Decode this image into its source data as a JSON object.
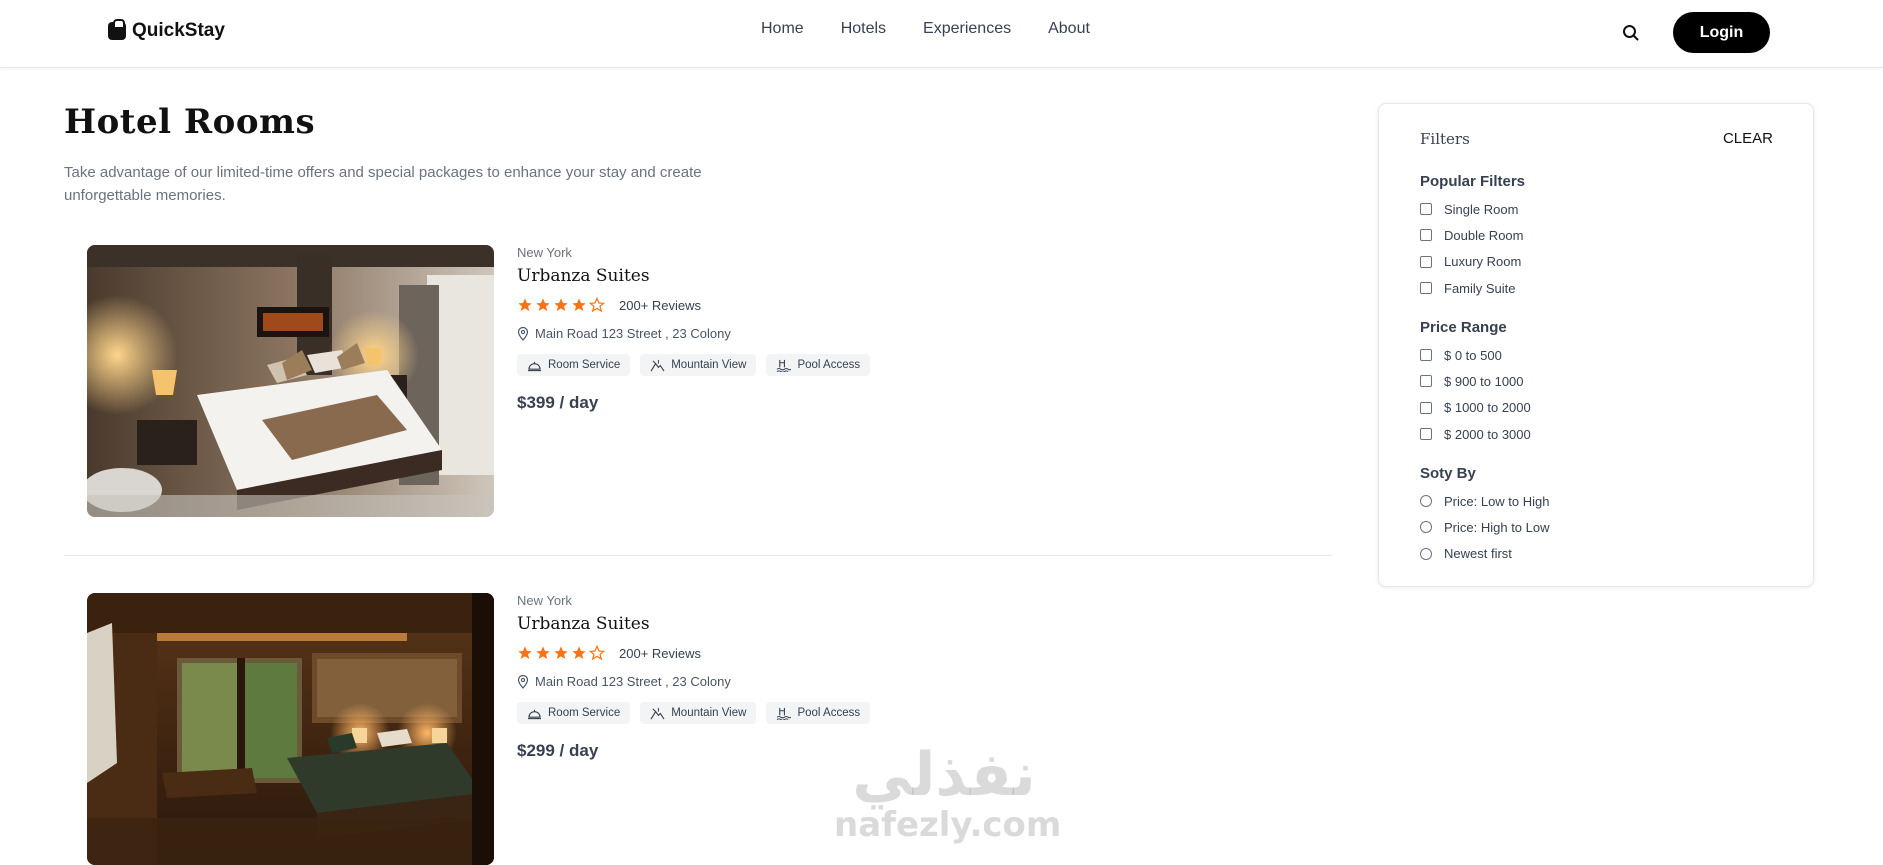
{
  "navbar": {
    "logo": "QuickStay",
    "links": [
      "Home",
      "Hotels",
      "Experiences",
      "About"
    ],
    "login_label": "Login"
  },
  "header": {
    "title": "Hotel Rooms",
    "subtitle": "Take advantage of our limited-time offers and special packages to enhance your stay and create unforgettable memories."
  },
  "rooms": [
    {
      "city": "New York",
      "name": "Urbanza Suites",
      "rating": 4,
      "reviews": "200+ Reviews",
      "address": "Main Road 123 Street , 23 Colony",
      "amenities": [
        "Room Service",
        "Mountain View",
        "Pool Access"
      ],
      "price": "$399 / day"
    },
    {
      "city": "New York",
      "name": "Urbanza Suites",
      "rating": 4,
      "reviews": "200+ Reviews",
      "address": "Main Road 123 Street , 23 Colony",
      "amenities": [
        "Room Service",
        "Mountain View",
        "Pool Access"
      ],
      "price": "$299 / day"
    }
  ],
  "filters": {
    "title": "Filters",
    "clear_label": "CLEAR",
    "popular": {
      "title": "Popular Filters",
      "options": [
        "Single Room",
        "Double Room",
        "Luxury Room",
        "Family Suite"
      ]
    },
    "price": {
      "title": "Price Range",
      "options": [
        "$ 0 to 500",
        "$ 900 to 1000",
        "$ 1000 to 2000",
        "$ 2000 to 3000"
      ]
    },
    "sort": {
      "title": "Soty By",
      "options": [
        "Price: Low to High",
        "Price: High to Low",
        "Newest first"
      ]
    }
  },
  "watermark": {
    "arabic": "نفذلي",
    "latin": "nafezly.com"
  },
  "colors": {
    "star": "#f97316",
    "login_bg": "#000000",
    "muted_text": "#6b7280"
  }
}
